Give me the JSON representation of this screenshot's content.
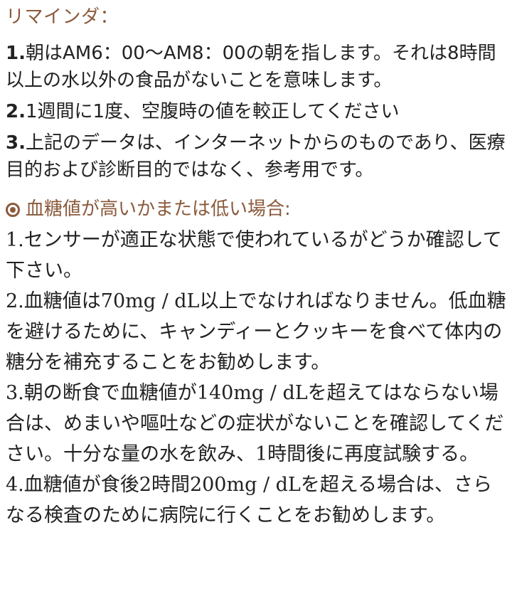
{
  "reminder": {
    "heading": "リマインダ：",
    "items": [
      {
        "num": "1.",
        "text": "朝はAM6：00〜AM8：00の朝を指します。それは8時間以上の水以外の食品がないことを意味します。"
      },
      {
        "num": "2.",
        "text": "1週間に1度、空腹時の値を較正してください"
      },
      {
        "num": "3.",
        "text": "上記のデータは、インターネットからのものであり、医療目的および診断目的ではなく、参考用です。"
      }
    ]
  },
  "glucose_advice": {
    "icon": "bullseye-icon",
    "heading": "血糖値が高いかまたは低い場合:",
    "items": [
      "1.センサーが適正な状態で使われているがどうか確認して下さい。",
      "2.血糖値は70mg / dL以上でなければなりません。低血糖を避けるために、キャンディーとクッキーを食べて体内の糖分を補充することをお勧めします。",
      "3.朝の断食で血糖値が140mg / dLを超えてはならない場合は、めまいや嘔吐などの症状がないことを確認してください。十分な量の水を飲み、1時間後に再度試験する。",
      "4.血糖値が食後2時間200mg / dLを超える場合は、さらなる検査のために病院に行くことをお勧めします。"
    ]
  },
  "colors": {
    "accent": "#8b5a3c",
    "text": "#222222",
    "background": "#ffffff"
  }
}
